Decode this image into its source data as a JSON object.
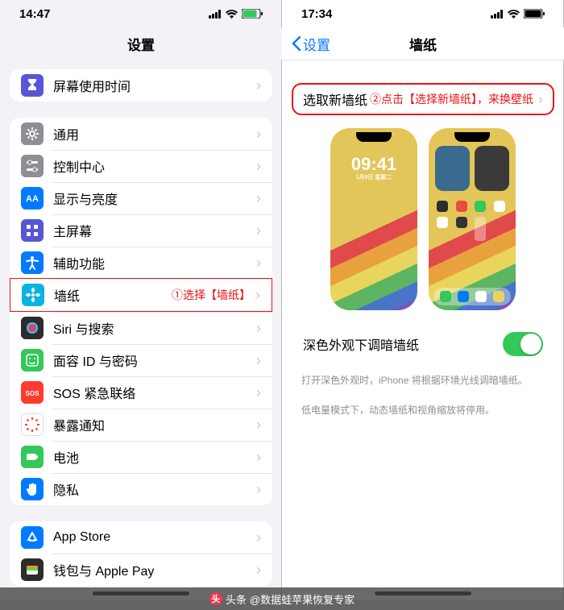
{
  "watermark": {
    "prefix": "头条",
    "author": "@数据蛙苹果恢复专家"
  },
  "left": {
    "status_time": "14:47",
    "nav_title": "设置",
    "group1": [
      {
        "label": "屏幕使用时间",
        "color": "c-purple",
        "icon": "hourglass"
      }
    ],
    "group2": [
      {
        "label": "通用",
        "color": "c-gray",
        "icon": "gear"
      },
      {
        "label": "控制中心",
        "color": "c-gray",
        "icon": "sliders"
      },
      {
        "label": "显示与亮度",
        "color": "c-blue",
        "icon": "AA"
      },
      {
        "label": "主屏幕",
        "color": "c-purple",
        "icon": "grid"
      },
      {
        "label": "辅助功能",
        "color": "c-blue",
        "icon": "accessibility"
      },
      {
        "label": "墙纸",
        "color": "c-cyan",
        "icon": "flower",
        "annot": "①选择【墙纸】",
        "hl": true
      },
      {
        "label": "Siri 与搜索",
        "color": "c-dark",
        "icon": "siri"
      },
      {
        "label": "面容 ID 与密码",
        "color": "c-green",
        "icon": "face"
      },
      {
        "label": "SOS 紧急联络",
        "color": "c-red",
        "icon": "SOS"
      },
      {
        "label": "暴露通知",
        "color": "",
        "icon": "exposure"
      },
      {
        "label": "电池",
        "color": "c-green",
        "icon": "battery"
      },
      {
        "label": "隐私",
        "color": "c-blue",
        "icon": "hand"
      }
    ],
    "group3": [
      {
        "label": "App Store",
        "color": "c-blue",
        "icon": "appstore"
      },
      {
        "label": "钱包与 Apple Pay",
        "color": "c-dark",
        "icon": "wallet"
      }
    ]
  },
  "right": {
    "status_time": "17:34",
    "back_label": "设置",
    "nav_title": "墙纸",
    "pick_new_label": "选取新墙纸",
    "pick_new_annot": "②点击【选择新墙纸】，来换壁纸",
    "preview_clock": "09:41",
    "preview_date": "1月9日 星期二",
    "dim_label": "深色外观下调暗墙纸",
    "hint1": "打开深色外观时，iPhone 将根据环境光线调暗墙纸。",
    "hint2": "低电量模式下，动态墙纸和视角缩放将停用。"
  }
}
